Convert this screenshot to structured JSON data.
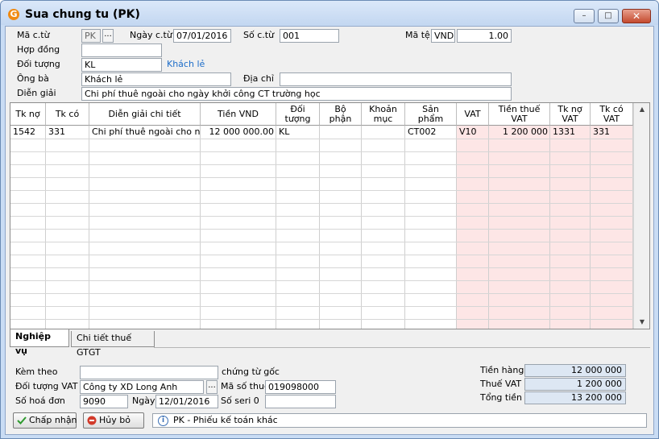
{
  "window": {
    "title": "Sua chung tu (PK)"
  },
  "header": {
    "ma_ct_label": "Mã c.từ",
    "ma_ct_value": "PK",
    "browse": "...",
    "ngay_ct_label": "Ngày c.từ",
    "ngay_ct_value": "07/01/2016",
    "so_ct_label": "Số c.từ",
    "so_ct_value": "001",
    "ma_te_label": "Mã tệ",
    "ma_te_value": "VND",
    "ty_gia_value": "1.00",
    "hop_dong_label": "Hợp đồng",
    "hop_dong_value": "",
    "doi_tuong_label": "Đối tượng",
    "doi_tuong_value": "KL",
    "doi_tuong_name": "Khách lẻ",
    "ong_ba_label": "Ông bà",
    "ong_ba_value": "Khách lẻ",
    "dia_chi_label": "Địa chỉ",
    "dia_chi_value": "",
    "dien_giai_label": "Diễn giải",
    "dien_giai_value": "Chi phí thuê ngoài cho ngày khởi công CT trường học"
  },
  "grid": {
    "columns": [
      "Tk nợ",
      "Tk có",
      "Diễn giải chi tiết",
      "Tiền VND",
      "Đối tượng",
      "Bộ phận",
      "Khoản mục",
      "Sản phẩm",
      "VAT",
      "Tiền thuế VAT",
      "Tk nợ VAT",
      "Tk có VAT"
    ],
    "rows": [
      [
        "1542",
        "331",
        "Chi phí thuê ngoài cho ngày",
        "12 000 000.00",
        "KL",
        "",
        "",
        "CT002",
        "V10",
        "1 200 000",
        "1331",
        "331"
      ]
    ]
  },
  "tabs": [
    {
      "label": "Nghiệp vụ",
      "active": true
    },
    {
      "label": "Chi tiết thuế GTGT",
      "active": false
    }
  ],
  "footer": {
    "kem_theo_label": "Kèm theo",
    "kem_theo_value": "",
    "chung_tu_goc_label": "chứng từ gốc",
    "doi_tuong_vat_label": "Đối tượng VAT",
    "doi_tuong_vat_value": "Công ty XD Long Anh",
    "ma_so_thue_label": "Mã số thuế",
    "ma_so_thue_value": "019098000",
    "so_hoa_don_label": "Số hoá đơn",
    "so_hoa_don_value": "9090",
    "ngay_label": "Ngày",
    "ngay_value": "12/01/2016",
    "so_seri_label": "Số seri 0",
    "so_seri_value": "",
    "tien_hang_label": "Tiền hàng",
    "tien_hang_value": "12 000 000",
    "thue_vat_label": "Thuế VAT",
    "thue_vat_value": "1 200 000",
    "tong_tien_label": "Tổng tiền",
    "tong_tien_value": "13 200 000"
  },
  "buttons": {
    "accept": "Chấp nhận",
    "cancel": "Hủy bỏ"
  },
  "status": {
    "text": "PK - Phiếu kế toán khác"
  },
  "colors": {
    "vat_column_bg": "#fde6e6",
    "link": "#1d6dc9",
    "title_bar": "#c9dcf4"
  }
}
